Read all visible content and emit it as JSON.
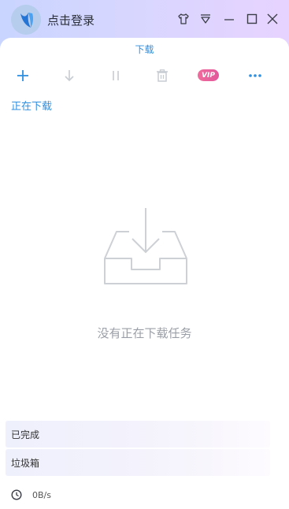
{
  "header": {
    "login_label": "点击登录"
  },
  "tab": {
    "label": "下载"
  },
  "toolbar": {
    "vip_label": "VIP",
    "buttons": [
      "add-icon",
      "download-icon",
      "pause-icon",
      "trash-icon",
      "vip-icon",
      "more-icon"
    ]
  },
  "section": {
    "title": "正在下载"
  },
  "empty_state": {
    "message": "没有正在下载任务",
    "icon": "download-tray-icon"
  },
  "sidebar": {
    "items": [
      {
        "label": "已完成"
      },
      {
        "label": "垃圾箱"
      }
    ]
  },
  "status": {
    "speed": "0B/s"
  },
  "colors": {
    "accent": "#2f8fe0",
    "vip": "#e2579b"
  }
}
